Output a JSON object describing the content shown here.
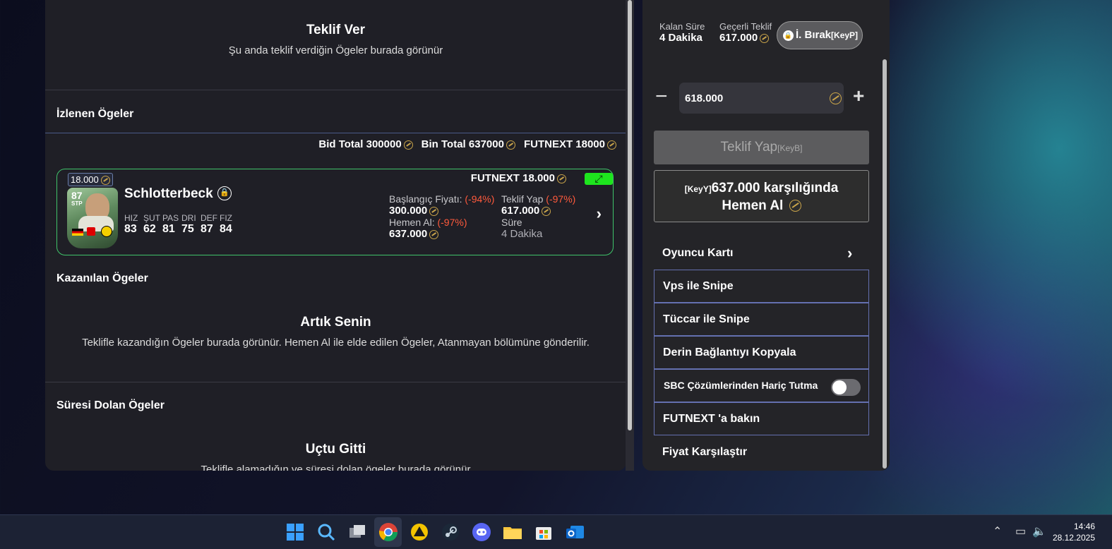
{
  "left": {
    "bids": {
      "title": "Teklif Ver",
      "subtitle": "Şu anda teklif verdiğin Ögeler burada görünür"
    },
    "watched": {
      "header": "İzlenen Ögeler"
    },
    "totals": {
      "bid_total": "Bid Total 300000",
      "bin_total": "Bin Total 637000",
      "futnext_total": "FUTNEXT 18000"
    },
    "card": {
      "price_chip": "18.000",
      "rating": "87",
      "position": "STP",
      "name": "Schlotterbeck",
      "futnext_price": "FUTNEXT 18.000",
      "expand_glyph": "⤢",
      "stats": [
        {
          "label": "HIZ",
          "value": "83"
        },
        {
          "label": "ŞUT",
          "value": "62"
        },
        {
          "label": "PAS",
          "value": "81"
        },
        {
          "label": "DRI",
          "value": "75"
        },
        {
          "label": "DEF",
          "value": "87"
        },
        {
          "label": "FIZ",
          "value": "84"
        }
      ],
      "start_price_label": "Başlangıç Fiyatı:",
      "start_price_pct": "(-94%)",
      "start_price": "300.000",
      "buy_now_label": "Hemen Al:",
      "buy_now_pct": "(-97%)",
      "buy_now": "637.000",
      "bid_label": "Teklif Yap",
      "bid_pct": "(-97%)",
      "bid_value": "617.000",
      "time_label": "Süre",
      "time_value": "4 Dakika"
    },
    "won": {
      "header": "Kazanılan Ögeler",
      "title": "Artık Senin",
      "subtitle": "Teklifle kazandığın Ögeler burada görünür. Hemen Al ile elde edilen Ögeler, Atanmayan bölümüne gönderilir."
    },
    "expired": {
      "header": "Süresi Dolan Ögeler",
      "title": "Uçtu Gitti",
      "subtitle": "Teklifle alamadığın ve süresi dolan ögeler burada görünür"
    }
  },
  "right": {
    "remaining_label": "Kalan Süre",
    "remaining_value": "4 Dakika",
    "current_bid_label": "Geçerli Teklif",
    "current_bid_value": "617.000",
    "release_label": "İ. Bırak",
    "release_key": "[KeyP]",
    "bid_input_value": "618.000",
    "bid_button_label": "Teklif Yap",
    "bid_button_key": "[KeyB]",
    "buy_key": "[KeyY]",
    "buy_line1": "637.000 karşılığında",
    "buy_line2": "Hemen Al",
    "player_card_label": "Oyuncu Kartı",
    "menu": [
      "Vps ile Snipe",
      "Tüccar ile Snipe",
      "Derin Bağlantıyı Kopyala",
      "SBC Çözümlerinden Hariç Tutma",
      "FUTNEXT 'a bakın"
    ],
    "sbc_toggle_on": false,
    "compare_label": "Fiyat Karşılaştır"
  },
  "taskbar": {
    "time": "14:46",
    "date": "28.12.2025",
    "icons": [
      "windows-icon",
      "search-icon",
      "task-view-icon",
      "chrome-icon",
      "app-icon",
      "steam-icon",
      "discord-icon",
      "file-explorer-icon",
      "store-icon",
      "outlook-icon"
    ]
  },
  "colors": {
    "accent_green": "#3fc46a",
    "warning_red": "#ff5a3c",
    "coin_gold": "#c9a44a",
    "menu_border": "#6470b0"
  }
}
